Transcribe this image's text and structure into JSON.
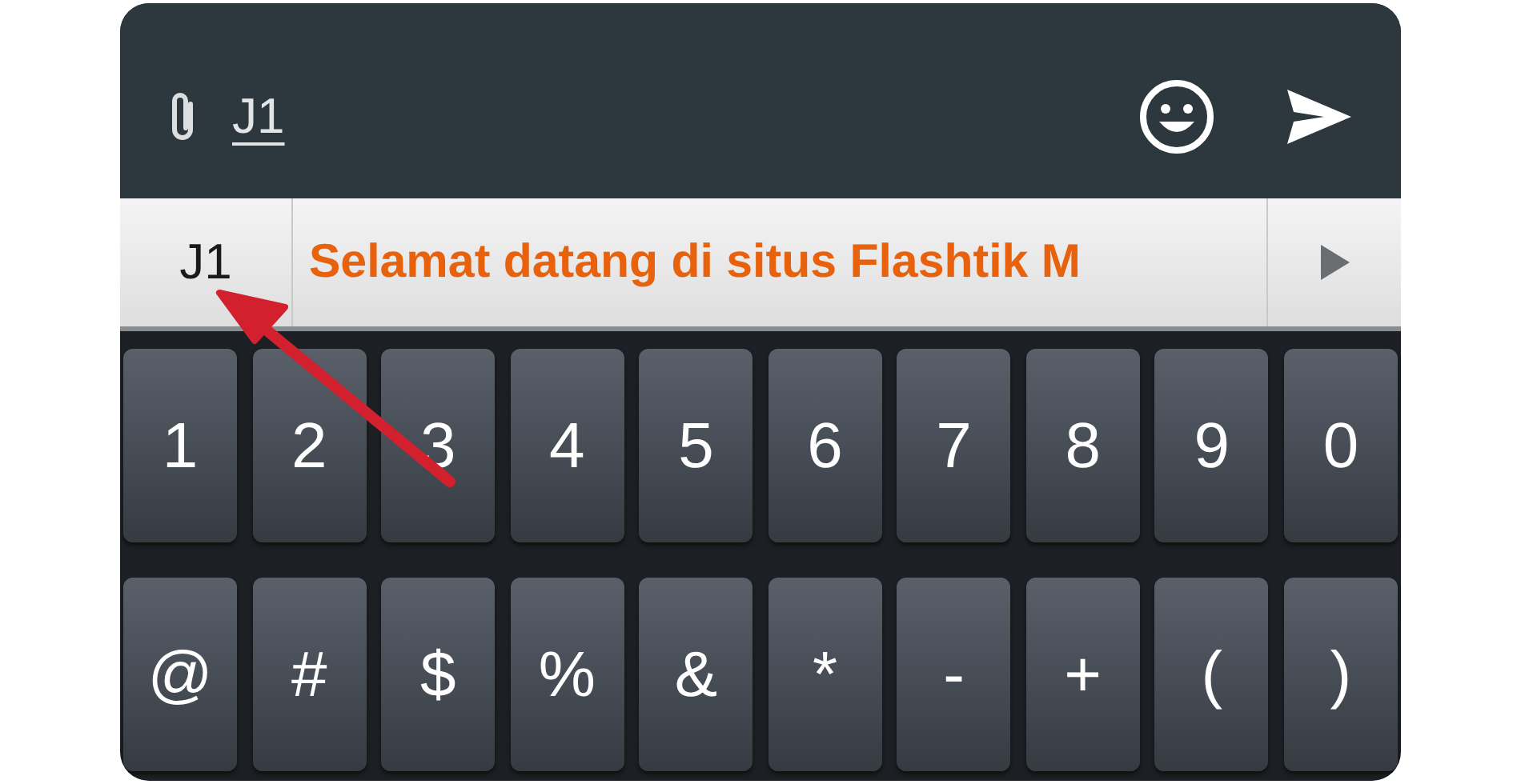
{
  "input_bar": {
    "text": "J1"
  },
  "suggestions": [
    {
      "text": "J1",
      "kind": "typed"
    },
    {
      "text": "Selamat datang di situs Flashtik M",
      "kind": "highlighted"
    }
  ],
  "keyboard": {
    "rows": [
      [
        "1",
        "2",
        "3",
        "4",
        "5",
        "6",
        "7",
        "8",
        "9",
        "0"
      ],
      [
        "@",
        "#",
        "$",
        "%",
        "&",
        "*",
        "-",
        "+",
        "(",
        ")"
      ]
    ]
  }
}
